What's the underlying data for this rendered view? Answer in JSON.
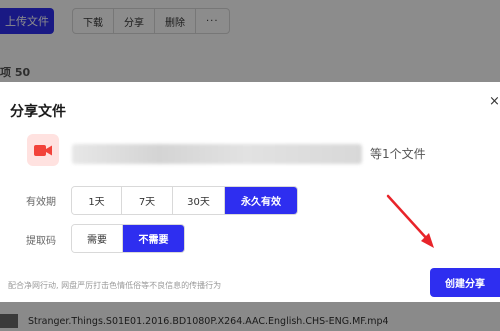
{
  "toolbar": {
    "upload_label": "上传文件",
    "actions": [
      {
        "name": "download-button",
        "label": "下载"
      },
      {
        "name": "share-button",
        "label": "分享"
      },
      {
        "name": "delete-button",
        "label": "删除"
      },
      {
        "name": "more-button",
        "label": "···"
      }
    ]
  },
  "list_header": {
    "count_text": "项 50"
  },
  "modal": {
    "title": "分享文件",
    "close_label": "×",
    "file_count": "等1个文件",
    "validity": {
      "label": "有效期",
      "options": [
        "1天",
        "7天",
        "30天",
        "永久有效"
      ],
      "selected": "永久有效"
    },
    "code": {
      "label": "提取码",
      "options": [
        "需要",
        "不需要"
      ],
      "selected": "不需要"
    },
    "notice": "配合净网行动, 网盘严厉打击色情低俗等不良信息的传播行为",
    "create_label": "创建分享"
  },
  "background_file": {
    "name": "Stranger.Things.S01E01.2016.BD1080P.X264.AAC.English.CHS-ENG.MF.mp4"
  },
  "colors": {
    "accent": "#2e2ef0",
    "annotation_arrow": "#e8242a",
    "file_icon_bg": "#ffe2e0",
    "file_icon_fg": "#f2433a"
  }
}
